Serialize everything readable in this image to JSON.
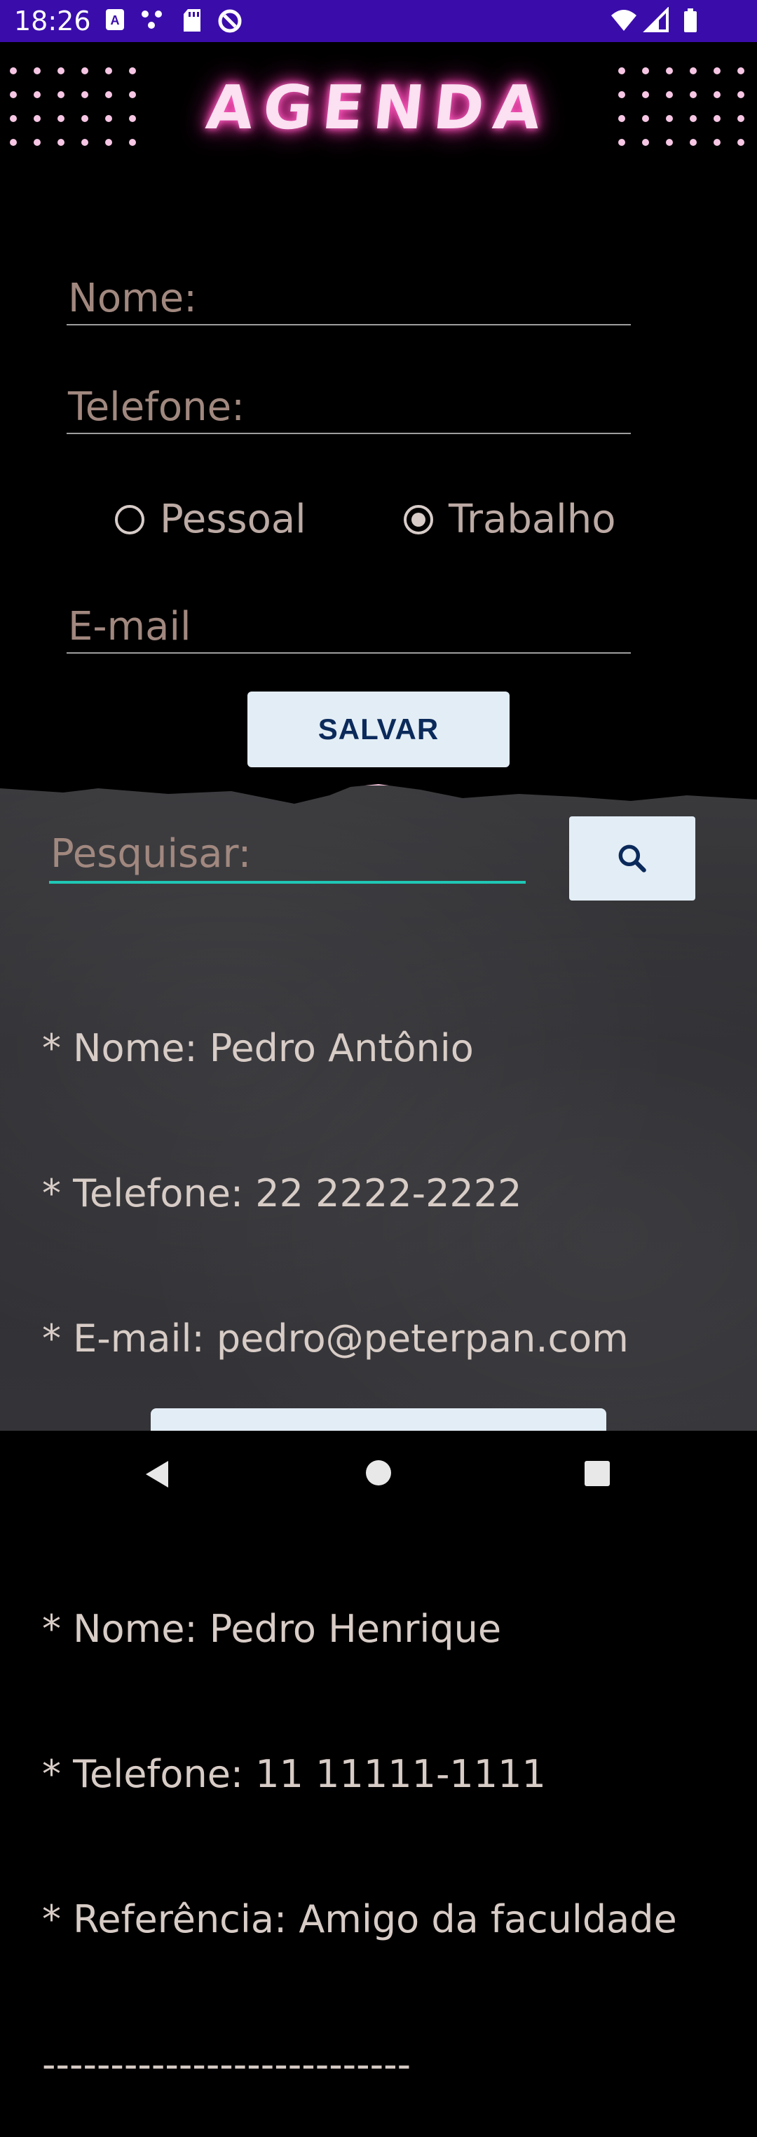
{
  "status_bar": {
    "time": "18:26",
    "icons": [
      "a-icon",
      "dots-icon",
      "sd-card-icon",
      "data-saver-icon"
    ],
    "right_icons": [
      "wifi-icon",
      "signal-icon",
      "battery-icon"
    ]
  },
  "header": {
    "title": "AGENDA"
  },
  "form": {
    "name_hint": "Nome:",
    "phone_hint": "Telefone:",
    "radio_personal": "Pessoal",
    "radio_work": "Trabalho",
    "selected": "Trabalho",
    "email_hint": "E-mail",
    "save_label": "SALVAR"
  },
  "search": {
    "placeholder": "Pesquisar:",
    "button_icon": "search-icon"
  },
  "results": [
    "* Nome: Pedro Antônio",
    "* Telefone: 22 2222-2222",
    "* E-mail: pedro@peterpan.com",
    "---------------------------",
    "* Nome: Pedro Henrique",
    "* Telefone: 11 11111-1111",
    "* Referência: Amigo da faculdade",
    "---------------------------"
  ],
  "colors": {
    "status_bar": "#3a0dab",
    "title_glow": "#ff3fb1",
    "accent_teal": "#1fc7b5",
    "button_bg": "#e3edf5",
    "button_text": "#0b2a5b",
    "pink_line": "#f8c8df"
  }
}
